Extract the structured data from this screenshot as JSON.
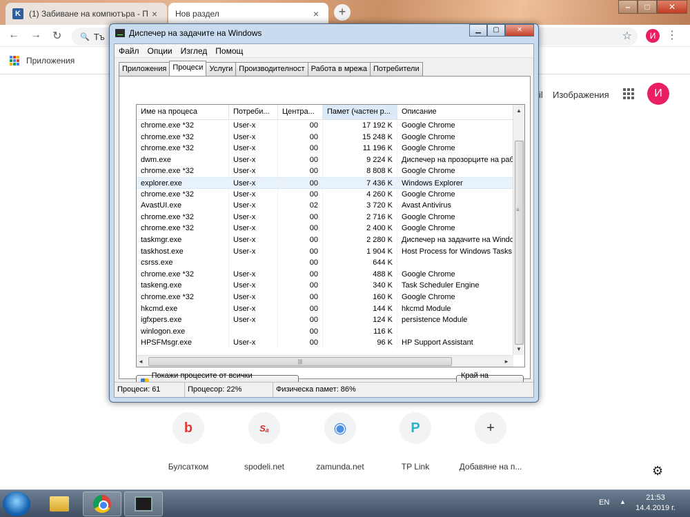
{
  "chrome": {
    "tabs": [
      {
        "label": "(1) Забиване на компютъра - П",
        "favicon": "K"
      },
      {
        "label": "Нов раздел"
      }
    ],
    "newtab_symbol": "+",
    "window_controls": {
      "minimize": "–",
      "maximize": "□",
      "close": "✕"
    },
    "nav": {
      "back": "←",
      "forward": "→",
      "reload": "↻"
    },
    "omnibox_text": "Тъ",
    "search_symbol": "🔍",
    "star_symbol": "☆",
    "menu_symbol": "⋮",
    "profile_letter": "И",
    "bookmarks": {
      "apps_label": "Приложения"
    }
  },
  "newtab": {
    "gmail_partial": "il",
    "images_label": "Изображения",
    "avatar_letter": "И",
    "shortcuts": [
      {
        "label": "Булсатком",
        "glyph": "b",
        "color": "#e53935"
      },
      {
        "label": "spodeli.net",
        "glyph": "Sₐ",
        "color": "#d32f2f"
      },
      {
        "label": "zamunda.net",
        "glyph": "◉",
        "color": "#4a90e2"
      },
      {
        "label": "TP Link",
        "glyph": "P",
        "color": "#26b3c9"
      },
      {
        "label": "Добавяне на п...",
        "glyph": "+",
        "color": "#333333"
      }
    ],
    "settings_icon": "⚙"
  },
  "taskmgr": {
    "title": "Диспечер на задачите на Windows",
    "controls": {
      "minimize": "▁",
      "maximize": "▢",
      "close": "✕"
    },
    "menu": [
      "Файл",
      "Опции",
      "Изглед",
      "Помощ"
    ],
    "tabs": [
      "Приложения",
      "Процеси",
      "Услуги",
      "Производителност",
      "Работа в мрежа",
      "Потребители"
    ],
    "active_tab": 1,
    "columns": [
      "Име на процеса",
      "Потреби...",
      "Центра...",
      "Памет (частен р...",
      "Описание"
    ],
    "processes": [
      {
        "name": "chrome.exe *32",
        "user": "User-x",
        "cpu": "00",
        "mem": "17 192 K",
        "desc": "Google Chrome"
      },
      {
        "name": "chrome.exe *32",
        "user": "User-x",
        "cpu": "00",
        "mem": "15 248 K",
        "desc": "Google Chrome"
      },
      {
        "name": "chrome.exe *32",
        "user": "User-x",
        "cpu": "00",
        "mem": "11 196 K",
        "desc": "Google Chrome"
      },
      {
        "name": "dwm.exe",
        "user": "User-x",
        "cpu": "00",
        "mem": "9 224 K",
        "desc": "Диспечер на прозорците на работ"
      },
      {
        "name": "chrome.exe *32",
        "user": "User-x",
        "cpu": "00",
        "mem": "8 808 K",
        "desc": "Google Chrome"
      },
      {
        "name": "explorer.exe",
        "user": "User-x",
        "cpu": "00",
        "mem": "7 436 K",
        "desc": "Windows Explorer"
      },
      {
        "name": "chrome.exe *32",
        "user": "User-x",
        "cpu": "00",
        "mem": "4 260 K",
        "desc": "Google Chrome"
      },
      {
        "name": "AvastUI.exe",
        "user": "User-x",
        "cpu": "02",
        "mem": "3 720 K",
        "desc": "Avast Antivirus"
      },
      {
        "name": "chrome.exe *32",
        "user": "User-x",
        "cpu": "00",
        "mem": "2 716 K",
        "desc": "Google Chrome"
      },
      {
        "name": "chrome.exe *32",
        "user": "User-x",
        "cpu": "00",
        "mem": "2 400 K",
        "desc": "Google Chrome"
      },
      {
        "name": "taskmgr.exe",
        "user": "User-x",
        "cpu": "00",
        "mem": "2 280 K",
        "desc": "Диспечер на задачите на Window"
      },
      {
        "name": "taskhost.exe",
        "user": "User-x",
        "cpu": "00",
        "mem": "1 904 K",
        "desc": "Host Process for Windows Tasks"
      },
      {
        "name": "csrss.exe",
        "user": "",
        "cpu": "00",
        "mem": "644 K",
        "desc": ""
      },
      {
        "name": "chrome.exe *32",
        "user": "User-x",
        "cpu": "00",
        "mem": "488 K",
        "desc": "Google Chrome"
      },
      {
        "name": "taskeng.exe",
        "user": "User-x",
        "cpu": "00",
        "mem": "340 K",
        "desc": "Task Scheduler Engine"
      },
      {
        "name": "chrome.exe *32",
        "user": "User-x",
        "cpu": "00",
        "mem": "160 K",
        "desc": "Google Chrome"
      },
      {
        "name": "hkcmd.exe",
        "user": "User-x",
        "cpu": "00",
        "mem": "144 K",
        "desc": "hkcmd Module"
      },
      {
        "name": "igfxpers.exe",
        "user": "User-x",
        "cpu": "00",
        "mem": "124 K",
        "desc": "persistence Module"
      },
      {
        "name": "winlogon.exe",
        "user": "",
        "cpu": "00",
        "mem": "116 K",
        "desc": ""
      },
      {
        "name": "HPSFMsgr.exe",
        "user": "User-x",
        "cpu": "00",
        "mem": "96 K",
        "desc": "HP Support Assistant"
      }
    ],
    "selected_row": 5,
    "show_all_label": "Покажи процесите от всички потребители",
    "end_process_label": "Край на процеса",
    "status": {
      "processes": "Процеси: 61",
      "cpu": "Процесор: 22%",
      "memory": "Физическа памет: 86%"
    }
  },
  "taskbar": {
    "language": "EN",
    "tray_arrow": "▲",
    "time": "21:53",
    "date": "14.4.2019 г."
  }
}
